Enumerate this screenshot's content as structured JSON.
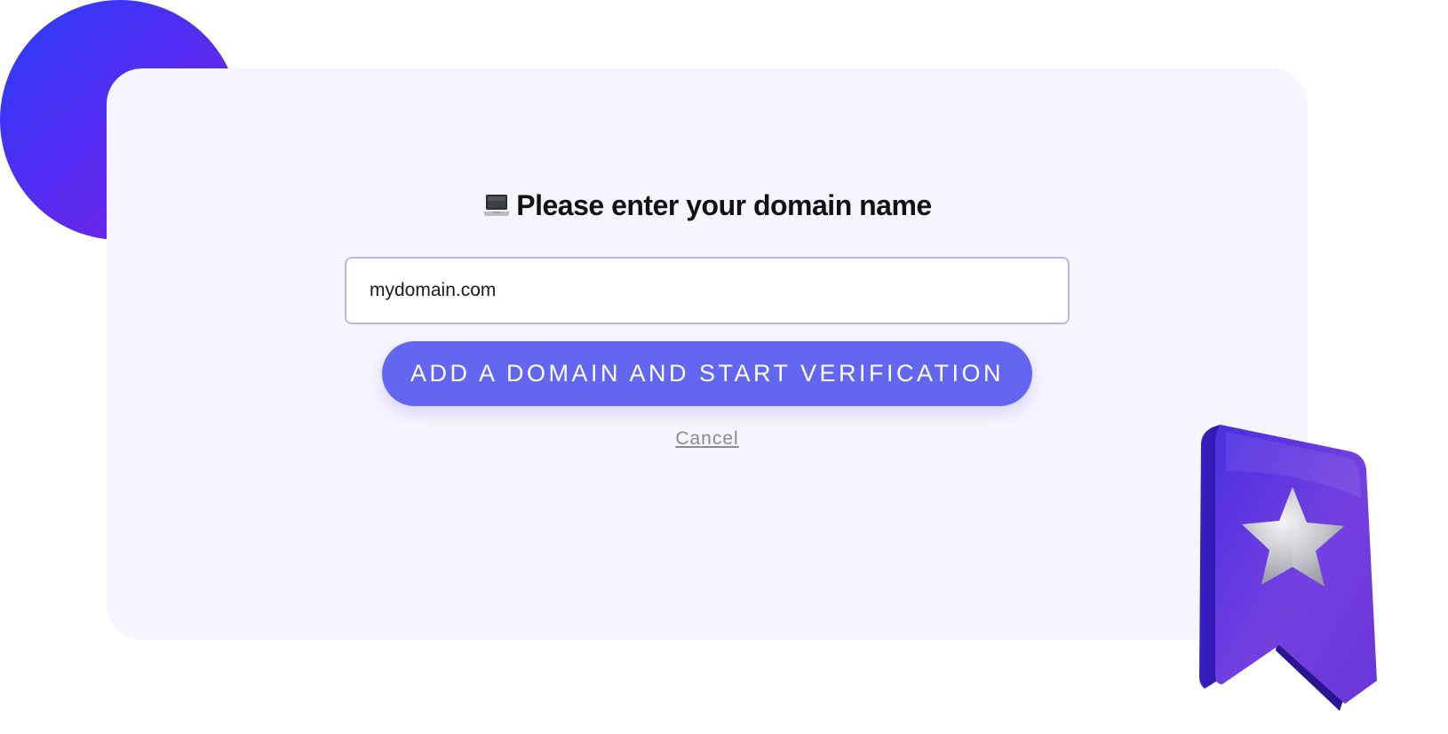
{
  "dialog": {
    "heading": "Please enter your domain name",
    "heading_icon": "laptop-icon",
    "domain_input": {
      "value": "mydomain.com",
      "placeholder": ""
    },
    "submit_label": "ADD A DOMAIN AND START VERIFICATION",
    "cancel_label": "Cancel"
  },
  "decorations": {
    "circle_icon": "gradient-circle",
    "badge_icon": "bookmark-star-icon"
  },
  "colors": {
    "accent": "#6366f1",
    "card_background": "#f7f5fd",
    "input_border": "#b9b6ea",
    "cancel_text": "#8a8894",
    "badge_purple": "#5a2bd6"
  }
}
